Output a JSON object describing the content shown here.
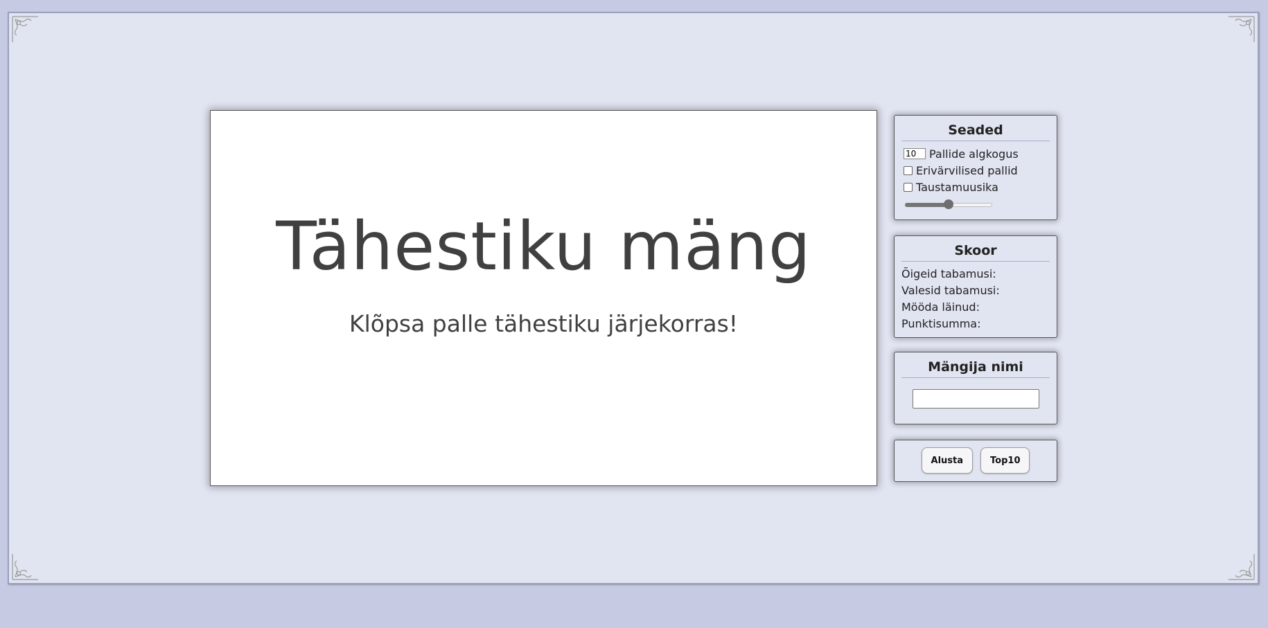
{
  "game": {
    "title": "Tähestiku mäng",
    "subtitle": "Klõpsa palle tähestiku järjekorras!"
  },
  "settings": {
    "heading": "Seaded",
    "ball_count_value": "10",
    "ball_count_label": "Pallide algkogus",
    "colored_balls_label": "Erivärvilised pallid",
    "colored_balls_checked": false,
    "music_label": "Taustamuusika",
    "music_checked": false,
    "volume_level": 0.5
  },
  "score": {
    "heading": "Skoor",
    "correct_label": "Õigeid tabamusi:",
    "wrong_label": "Valesid tabamusi:",
    "missed_label": "Mööda läinud:",
    "total_label": "Punktisumma:"
  },
  "player": {
    "heading": "Mängija nimi",
    "name_value": ""
  },
  "actions": {
    "start_label": "Alusta",
    "top10_label": "Top10"
  },
  "colors": {
    "page_background": "#c6cae2",
    "panel_background": "#e1e4f1",
    "title_text": "#404040"
  }
}
